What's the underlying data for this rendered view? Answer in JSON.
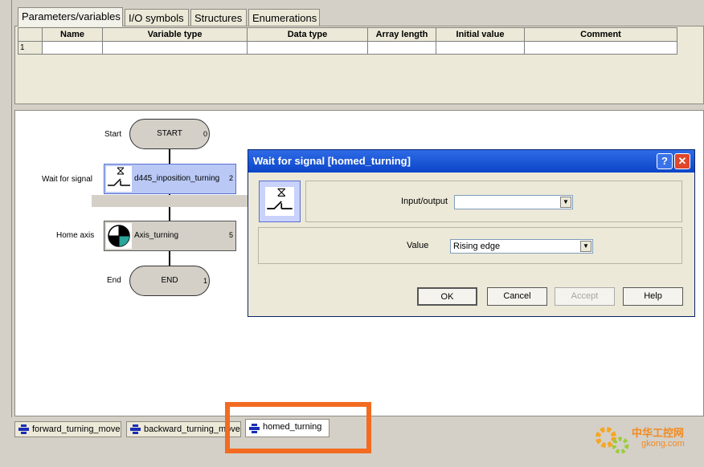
{
  "top_tabs": [
    "Parameters/variables",
    "I/O symbols",
    "Structures",
    "Enumerations"
  ],
  "table": {
    "columns": [
      "Name",
      "Variable type",
      "Data type",
      "Array length",
      "Initial value",
      "Comment"
    ],
    "rows": [
      {
        "num": "1"
      }
    ]
  },
  "flow": {
    "start_label": "Start",
    "start_text": "START",
    "start_num": "0",
    "wait_label": "Wait for signal",
    "wait_text": "d445_inposition_turning",
    "wait_num": "2",
    "home_label": "Home axis",
    "home_text": "Axis_turning",
    "home_num": "5",
    "end_label": "End",
    "end_text": "END",
    "end_num": "1"
  },
  "dialog": {
    "title": "Wait for signal [homed_turning]",
    "help_glyph": "?",
    "close_glyph": "✕",
    "io_label": "Input/output",
    "io_value": "",
    "value_label": "Value",
    "value_selected": "Rising edge",
    "ok": "OK",
    "cancel": "Cancel",
    "accept": "Accept",
    "help": "Help"
  },
  "bottom_tabs": [
    "forward_turning_move",
    "backward_turning_move",
    "homed_turning"
  ],
  "watermark": {
    "brand": "中华工控网",
    "domain": "gkong.com"
  },
  "colors": {
    "highlight": "#f26b21",
    "title_bar": "#0b45c8",
    "close": "#e0462a"
  }
}
